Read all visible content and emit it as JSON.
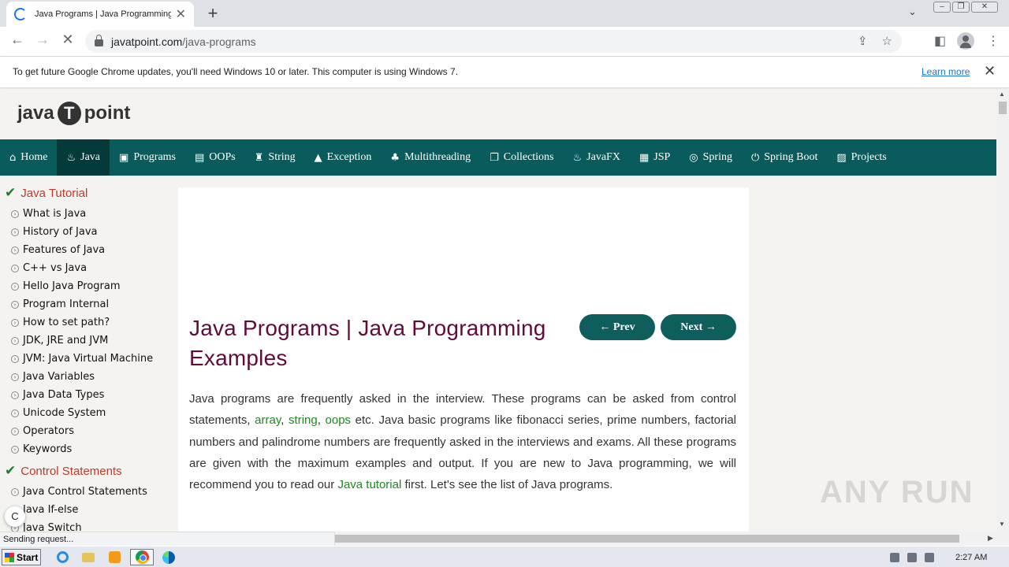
{
  "browser": {
    "tab_title": "Java Programs | Java Programming E",
    "tab_close": "✕",
    "new_tab": "+",
    "url_host": "javatpoint.com",
    "url_path": "/java-programs"
  },
  "infobar": {
    "message": "To get future Google Chrome updates, you'll need Windows 10 or later. This computer is using Windows 7.",
    "link": "Learn more"
  },
  "site": {
    "logo_left": "java",
    "logo_mid": "T",
    "logo_right": "point"
  },
  "nav": [
    {
      "label": "Home",
      "icon": "⌂"
    },
    {
      "label": "Java",
      "icon": "♨"
    },
    {
      "label": "Programs",
      "icon": "▣"
    },
    {
      "label": "OOPs",
      "icon": "▤"
    },
    {
      "label": "String",
      "icon": "♜"
    },
    {
      "label": "Exception",
      "icon": "▲"
    },
    {
      "label": "Multithreading",
      "icon": "♣"
    },
    {
      "label": "Collections",
      "icon": "❐"
    },
    {
      "label": "JavaFX",
      "icon": "♨"
    },
    {
      "label": "JSP",
      "icon": "▦"
    },
    {
      "label": "Spring",
      "icon": "◎"
    },
    {
      "label": "Spring Boot",
      "icon": "⏻"
    },
    {
      "label": "Projects",
      "icon": "▨"
    }
  ],
  "sidebar": {
    "section1": "Java Tutorial",
    "items1": [
      "What is Java",
      "History of Java",
      "Features of Java",
      "C++ vs Java",
      "Hello Java Program",
      "Program Internal",
      "How to set path?",
      "JDK, JRE and JVM",
      "JVM: Java Virtual Machine",
      "Java Variables",
      "Java Data Types",
      "Unicode System",
      "Operators",
      "Keywords"
    ],
    "section2": "Control Statements",
    "items2": [
      "Java Control Statements",
      "Java If-else",
      "Java Switch"
    ]
  },
  "main": {
    "title": "Java Programs | Java Programming Examples",
    "prev": "← Prev",
    "next": "Next →",
    "intro_1": "Java programs are frequently asked in the interview. These programs can be asked from control statements, ",
    "link_array": "array",
    "sep_1": ", ",
    "link_string": "string",
    "sep_2": ", ",
    "link_oops": "oops",
    "intro_2": " etc. Java basic programs like fibonacci series, prime numbers, factorial numbers and palindrome numbers are frequently asked in the interviews and exams. All these programs are given with the maximum examples and output. If you are new to Java programming, we will recommend you to read our ",
    "link_tutorial": "Java tutorial",
    "intro_3": " first. Let's see the list of Java programs."
  },
  "status_text": "Sending request...",
  "c_badge": "C",
  "watermark": "ANY RUN",
  "taskbar": {
    "start": "Start",
    "time": "2:27 AM"
  }
}
